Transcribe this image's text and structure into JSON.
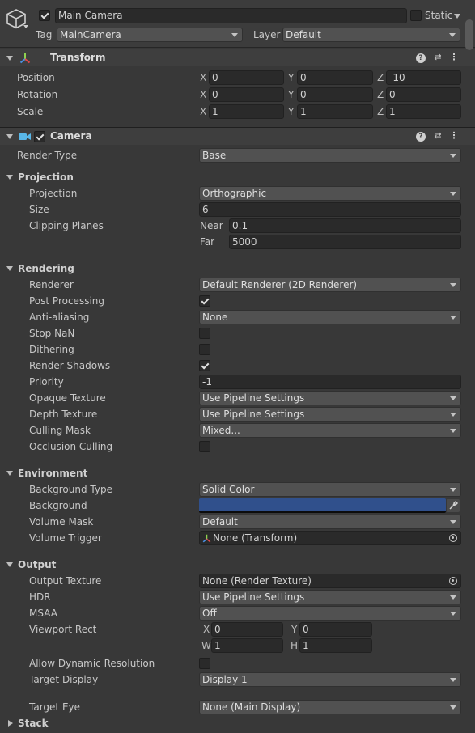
{
  "header": {
    "name": "Main Camera",
    "static_label": "Static",
    "tag_label": "Tag",
    "tag_value": "MainCamera",
    "layer_label": "Layer",
    "layer_value": "Default"
  },
  "transform": {
    "title": "Transform",
    "position_label": "Position",
    "rotation_label": "Rotation",
    "scale_label": "Scale",
    "axis_x": "X",
    "axis_y": "Y",
    "axis_z": "Z",
    "position": {
      "x": "0",
      "y": "0",
      "z": "-10"
    },
    "rotation": {
      "x": "0",
      "y": "0",
      "z": "0"
    },
    "scale": {
      "x": "1",
      "y": "1",
      "z": "1"
    }
  },
  "camera": {
    "title": "Camera",
    "render_type_label": "Render Type",
    "render_type_value": "Base"
  },
  "projection": {
    "title": "Projection",
    "projection_label": "Projection",
    "projection_value": "Orthographic",
    "size_label": "Size",
    "size_value": "6",
    "clipping_label": "Clipping Planes",
    "near_label": "Near",
    "near_value": "0.1",
    "far_label": "Far",
    "far_value": "5000"
  },
  "rendering": {
    "title": "Rendering",
    "renderer_label": "Renderer",
    "renderer_value": "Default Renderer (2D Renderer)",
    "post_processing_label": "Post Processing",
    "post_processing_checked": true,
    "anti_aliasing_label": "Anti-aliasing",
    "anti_aliasing_value": "None",
    "stop_nan_label": "Stop NaN",
    "stop_nan_checked": false,
    "dithering_label": "Dithering",
    "dithering_checked": false,
    "render_shadows_label": "Render Shadows",
    "render_shadows_checked": true,
    "priority_label": "Priority",
    "priority_value": "-1",
    "opaque_texture_label": "Opaque Texture",
    "opaque_texture_value": "Use Pipeline Settings",
    "depth_texture_label": "Depth Texture",
    "depth_texture_value": "Use Pipeline Settings",
    "culling_mask_label": "Culling Mask",
    "culling_mask_value": "Mixed...",
    "occlusion_culling_label": "Occlusion Culling",
    "occlusion_culling_checked": false
  },
  "environment": {
    "title": "Environment",
    "background_type_label": "Background Type",
    "background_type_value": "Solid Color",
    "background_label": "Background",
    "background_color": "#30508c",
    "volume_mask_label": "Volume Mask",
    "volume_mask_value": "Default",
    "volume_trigger_label": "Volume Trigger",
    "volume_trigger_value": "None (Transform)"
  },
  "output": {
    "title": "Output",
    "output_texture_label": "Output Texture",
    "output_texture_value": "None (Render Texture)",
    "hdr_label": "HDR",
    "hdr_value": "Use Pipeline Settings",
    "msaa_label": "MSAA",
    "msaa_value": "Off",
    "viewport_label": "Viewport Rect",
    "vp_x_label": "X",
    "vp_x": "0",
    "vp_y_label": "Y",
    "vp_y": "0",
    "vp_w_label": "W",
    "vp_w": "1",
    "vp_h_label": "H",
    "vp_h": "1",
    "dynamic_res_label": "Allow Dynamic Resolution",
    "dynamic_res_checked": false,
    "target_display_label": "Target Display",
    "target_display_value": "Display 1",
    "target_eye_label": "Target Eye",
    "target_eye_value": "None (Main Display)"
  },
  "stack": {
    "title": "Stack"
  },
  "colors": {
    "background": "#383838",
    "header": "#3e3e3e",
    "field": "#2a2a2a",
    "dropdown": "#515151",
    "camera_icon": "#59b7e8"
  }
}
